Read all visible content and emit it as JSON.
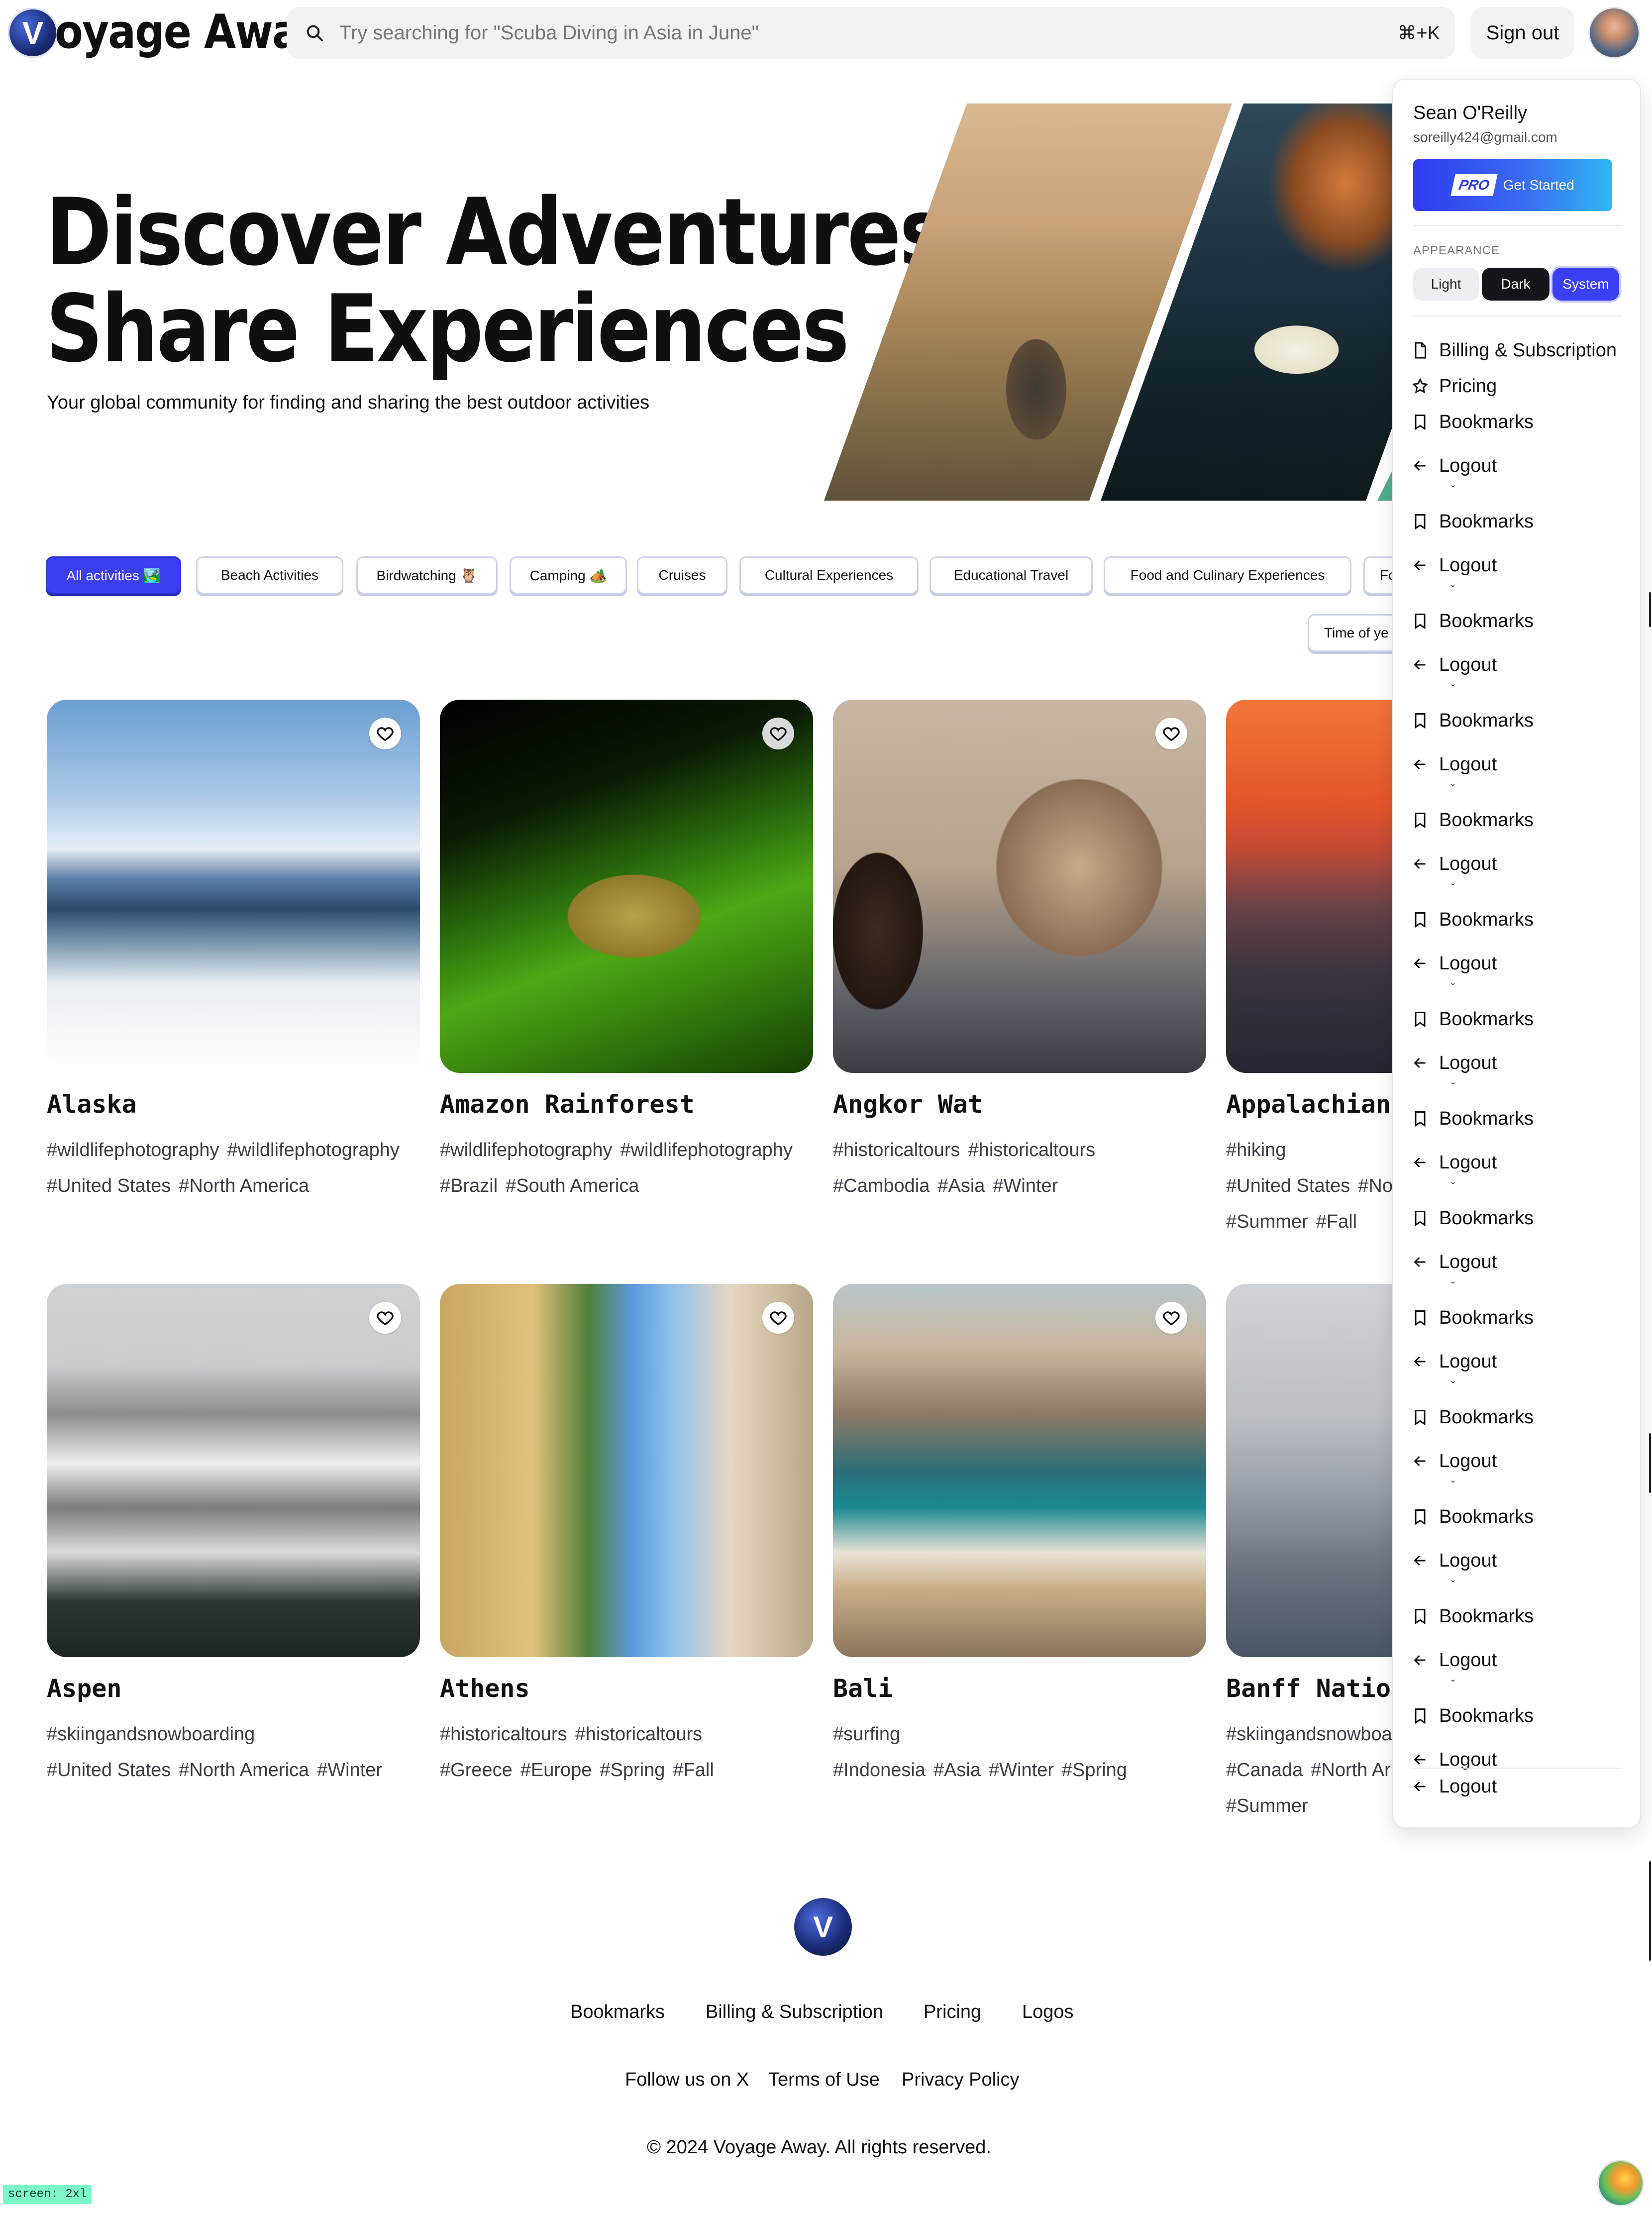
{
  "header": {
    "logo_letter": "V",
    "brand": "oyage Away",
    "search_placeholder": "Try searching for \"Scuba Diving in Asia in June\"",
    "shortcut": "⌘+K",
    "signout_label": "Sign out"
  },
  "hero": {
    "title_line1": "Discover Adventures,",
    "title_line2": "Share Experiences",
    "subtitle": "Your global community for finding and sharing the best outdoor activities"
  },
  "filters": [
    {
      "label": "All activities 🏞️",
      "active": true
    },
    {
      "label": "Beach Activities"
    },
    {
      "label": "Birdwatching 🦉"
    },
    {
      "label": "Camping 🏕️"
    },
    {
      "label": "Cruises"
    },
    {
      "label": "Cultural Experiences"
    },
    {
      "label": "Educational Travel"
    },
    {
      "label": "Food and Culinary Experiences"
    },
    {
      "label": "Fo"
    }
  ],
  "time_filter_label": "Time of ye",
  "cards": [
    {
      "title": "Alaska",
      "tags1": [
        "#wildlifephotography",
        "#wildlifephotography"
      ],
      "tags2": [
        "#United States",
        "#North America"
      ],
      "tags3": []
    },
    {
      "title": "Amazon Rainforest",
      "tags1": [
        "#wildlifephotography",
        "#wildlifephotography"
      ],
      "tags2": [
        "#Brazil",
        "#South America"
      ],
      "tags3": []
    },
    {
      "title": "Angkor Wat",
      "tags1": [
        "#historicaltours",
        "#historicaltours"
      ],
      "tags2": [
        "#Cambodia",
        "#Asia",
        "#Winter"
      ],
      "tags3": []
    },
    {
      "title": "Appalachian",
      "tags1": [
        "#hiking"
      ],
      "tags2": [
        "#United States",
        "#No"
      ],
      "tags3": [
        "#Summer",
        "#Fall"
      ]
    },
    {
      "title": "Aspen",
      "tags1": [
        "#skiingandsnowboarding"
      ],
      "tags2": [
        "#United States",
        "#North America",
        "#Winter"
      ],
      "tags3": []
    },
    {
      "title": "Athens",
      "tags1": [
        "#historicaltours",
        "#historicaltours"
      ],
      "tags2": [
        "#Greece",
        "#Europe",
        "#Spring",
        "#Fall"
      ],
      "tags3": []
    },
    {
      "title": "Bali",
      "tags1": [
        "#surfing"
      ],
      "tags2": [
        "#Indonesia",
        "#Asia",
        "#Winter",
        "#Spring"
      ],
      "tags3": []
    },
    {
      "title": "Banff Nation",
      "tags1": [
        "#skiingandsnowboa"
      ],
      "tags2": [
        "#Canada",
        "#North Ar"
      ],
      "tags3": [
        "#Summer"
      ]
    }
  ],
  "menu": {
    "name": "Sean O'Reilly",
    "email": "soreilly424@gmail.com",
    "pro_badge": "PRO",
    "pro_label": "Get Started",
    "appearance_label": "APPEARANCE",
    "appearance_options": [
      "Light",
      "Dark",
      "System"
    ],
    "appearance_selected": "System",
    "billing": "Billing & Subscription",
    "pricing": "Pricing",
    "repeat_bookmarks": "Bookmarks",
    "repeat_logout": "Logout",
    "last_logout": "Logout"
  },
  "footer": {
    "logo_letter": "V",
    "links_row1": [
      "Bookmarks",
      "Billing & Subscription",
      "Pricing",
      "Logos"
    ],
    "links_row2": [
      "Follow us on X",
      "Terms of Use",
      "Privacy Policy"
    ],
    "copyright": "© 2024 Voyage Away. All rights reserved."
  },
  "screen_badge": "screen: 2xl"
}
